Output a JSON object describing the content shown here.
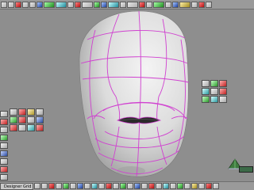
{
  "taskbar": {
    "active_window_label": "Designer Grid"
  },
  "colors": {
    "background": "#8e8e8e",
    "mesh_surface": "#e4e4e4",
    "mesh_curves": "#d040d0"
  },
  "icons": {
    "top_toolbar": [
      "file-icon",
      "save-icon",
      "undo-icon",
      "redo-icon",
      "pick-icon",
      "move-icon",
      "rotate-icon",
      "scale-icon",
      "select-icon",
      "curve-icon",
      "surface-icon",
      "view-icon",
      "light-icon",
      "render-icon",
      "camera-icon",
      "grid-icon",
      "snap-icon",
      "layer-icon",
      "edit-icon",
      "tool-icon",
      "object-icon",
      "shader-icon",
      "anim-icon",
      "play-icon",
      "help-icon"
    ],
    "left_palette": [
      "brush-icon",
      "pen-icon",
      "lasso-icon",
      "knife-icon",
      "sculpt-icon",
      "smooth-icon",
      "pinch-icon",
      "pull-icon"
    ],
    "right_palette": [
      "blend-icon",
      "cv-icon",
      "warp-icon",
      "twist-icon",
      "bend-icon",
      "close-icon",
      "extend-icon",
      "fillet-icon",
      "trim-icon"
    ]
  }
}
